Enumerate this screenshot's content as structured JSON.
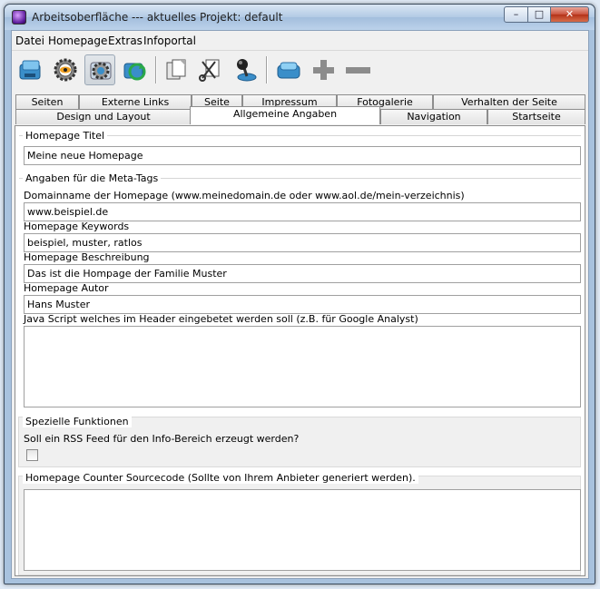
{
  "window": {
    "title": "Arbeitsoberfläche --- aktuelles Projekt: default"
  },
  "menu": [
    "Datei",
    "Homepage",
    "Extras",
    "Infoportal"
  ],
  "toolbar": {
    "icons": [
      "disk-icon",
      "gear-eye-icon",
      "settings-icon",
      "refresh-icon",
      "document-icon",
      "cut-icon",
      "joystick-icon",
      "disk-blue-icon",
      "plus-icon",
      "minus-icon"
    ]
  },
  "tabs": {
    "row1": [
      "Seiten",
      "Externe Links",
      "Seite",
      "Impressum",
      "Fotogalerie",
      "Verhalten der Seite"
    ],
    "row2": [
      "Design und Layout",
      "Allgemeine Angaben",
      "Navigation",
      "Startseite"
    ],
    "active": "Allgemeine Angaben"
  },
  "form": {
    "title_group": "Homepage Titel",
    "title_value": "Meine neue Homepage",
    "meta_group": "Angaben für die Meta-Tags",
    "domain_label": "Domainname der Homepage (www.meinedomain.de oder www.aol.de/mein-verzeichnis)",
    "domain_value": "www.beispiel.de",
    "keywords_label": "Homepage Keywords",
    "keywords_value": "beispiel, muster, ratlos",
    "desc_label": "Homepage Beschreibung",
    "desc_value": "Das ist die Hompage der Familie Muster",
    "author_label": "Homepage Autor",
    "author_value": "Hans Muster",
    "js_label": "Java Script welches im Header eingebetet werden soll (z.B. für Google Analyst)",
    "special_group": "Spezielle Funktionen",
    "rss_label": "Soll ein RSS Feed für den Info-Bereich erzeugt werden?",
    "rss_checked": false,
    "counter_group": "Homepage Counter Sourcecode (Sollte von Ihrem Anbieter generiert werden)."
  },
  "colors": {
    "window_frame": "#a8c2de",
    "close_button": "#c9513b",
    "panel_bg": "#ffffff"
  }
}
